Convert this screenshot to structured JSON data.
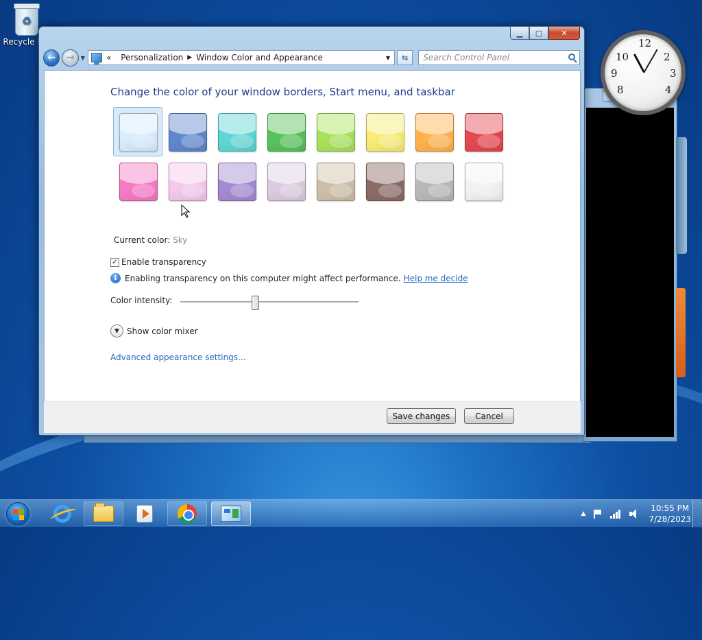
{
  "desktop": {
    "recycle_bin_label": "Recycle Bin"
  },
  "clock_gadget": {
    "numbers": [
      "12",
      "2",
      "3",
      "4",
      "8",
      "9",
      "10"
    ]
  },
  "window": {
    "address": {
      "overflow_glyph": "«",
      "crumbs": [
        "Personalization",
        "Window Color and Appearance"
      ]
    },
    "search_placeholder": "Search Control Panel",
    "heading": "Change the color of your window borders, Start menu, and taskbar",
    "swatch_colors": [
      [
        "#d6ecff",
        "#5f87cc",
        "#5fd6d4",
        "#57c25c",
        "#a8e25a",
        "#f7ec74",
        "#ffb24c",
        "#e5484f"
      ],
      [
        "#f67ac4",
        "#f5c8ec",
        "#a58ad3",
        "#dccbe0",
        "#cdbfa7",
        "#8c6b66",
        "#b8b8b8",
        "#f2f2f2"
      ]
    ],
    "selected_swatch": 0,
    "current_color_label": "Current color:",
    "current_color_value": "Sky",
    "transparency_label": "Enable transparency",
    "transparency_checked": true,
    "info_text": "Enabling transparency on this computer might affect performance.",
    "help_link": "Help me decide",
    "intensity_label": "Color intensity:",
    "intensity_value": 0.42,
    "mixer_label": "Show color mixer",
    "advanced_link": "Advanced appearance settings...",
    "save_button": "Save changes",
    "cancel_button": "Cancel"
  },
  "taskbar": {
    "time": "10:55 PM",
    "date": "7/28/2023",
    "items": [
      "internet-explorer",
      "windows-explorer",
      "media-player",
      "chrome",
      "control-panel"
    ],
    "active_item": "control-panel"
  },
  "colors": {
    "heading": "#1e3c8c",
    "link": "#1f66bf",
    "selection_bg": "#dbeaf8"
  }
}
